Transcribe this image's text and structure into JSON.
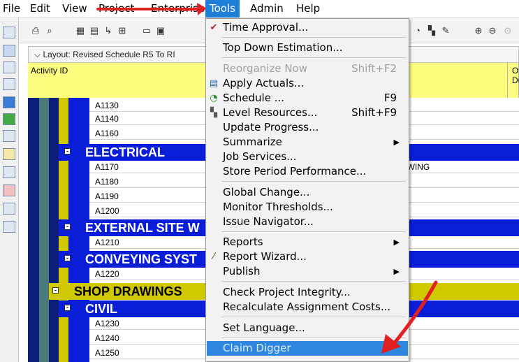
{
  "menubar": {
    "file": "File",
    "edit": "Edit",
    "view": "View",
    "project": "Project",
    "enterprise": "Enterprise",
    "tools": "Tools",
    "admin": "Admin",
    "help": "Help"
  },
  "layout": {
    "label": "Layout: Revised Schedule R5 To RI",
    "col_activity_id": "Activity ID",
    "col_original_duration_1": "O",
    "col_original_duration_2": "Du"
  },
  "rows": [
    {
      "id": "A1130",
      "name": ""
    },
    {
      "id": "A1140",
      "name": ""
    },
    {
      "id": "A1160",
      "name": ""
    },
    {
      "group": "ELECTRICAL"
    },
    {
      "id": "A1170",
      "name": "AWING"
    },
    {
      "id": "A1180",
      "name": ""
    },
    {
      "id": "A1190",
      "name": ""
    },
    {
      "id": "A1200",
      "name": ""
    },
    {
      "group": "EXTERNAL SITE W"
    },
    {
      "id": "A1210",
      "name": ""
    },
    {
      "group": "CONVEYING SYST"
    },
    {
      "id": "A1220",
      "name": ""
    },
    {
      "group": "SHOP DRAWINGS"
    },
    {
      "group": "CIVIL"
    },
    {
      "id": "A1230",
      "name": ""
    },
    {
      "id": "A1240",
      "name": ""
    },
    {
      "id": "A1250",
      "name": ""
    }
  ],
  "tools_menu": {
    "time_approval": "Time Approval...",
    "top_down_estimation": "Top Down Estimation...",
    "reorganize_now": "Reorganize Now",
    "reorganize_now_shortcut": "Shift+F2",
    "apply_actuals": "Apply Actuals...",
    "schedule": "Schedule ...",
    "schedule_shortcut": "F9",
    "level_resources": "Level Resources...",
    "level_resources_shortcut": "Shift+F9",
    "update_progress": "Update Progress...",
    "summarize": "Summarize",
    "job_services": "Job Services...",
    "store_period_performance": "Store Period Performance...",
    "global_change": "Global Change...",
    "monitor_thresholds": "Monitor Thresholds...",
    "issue_navigator": "Issue Navigator...",
    "reports": "Reports",
    "report_wizard": "Report Wizard...",
    "publish": "Publish",
    "check_project_integrity": "Check Project Integrity...",
    "recalculate_assignment_costs": "Recalculate Assignment Costs...",
    "set_language": "Set Language...",
    "claim_digger": "Claim Digger"
  },
  "colors": {
    "menu_highlight": "#2f86de",
    "group_band_blue": "#0a1ed8",
    "group_band_yellow": "#d0c800",
    "header_yellow": "#fdfd80",
    "annotation_red": "#e02020"
  }
}
